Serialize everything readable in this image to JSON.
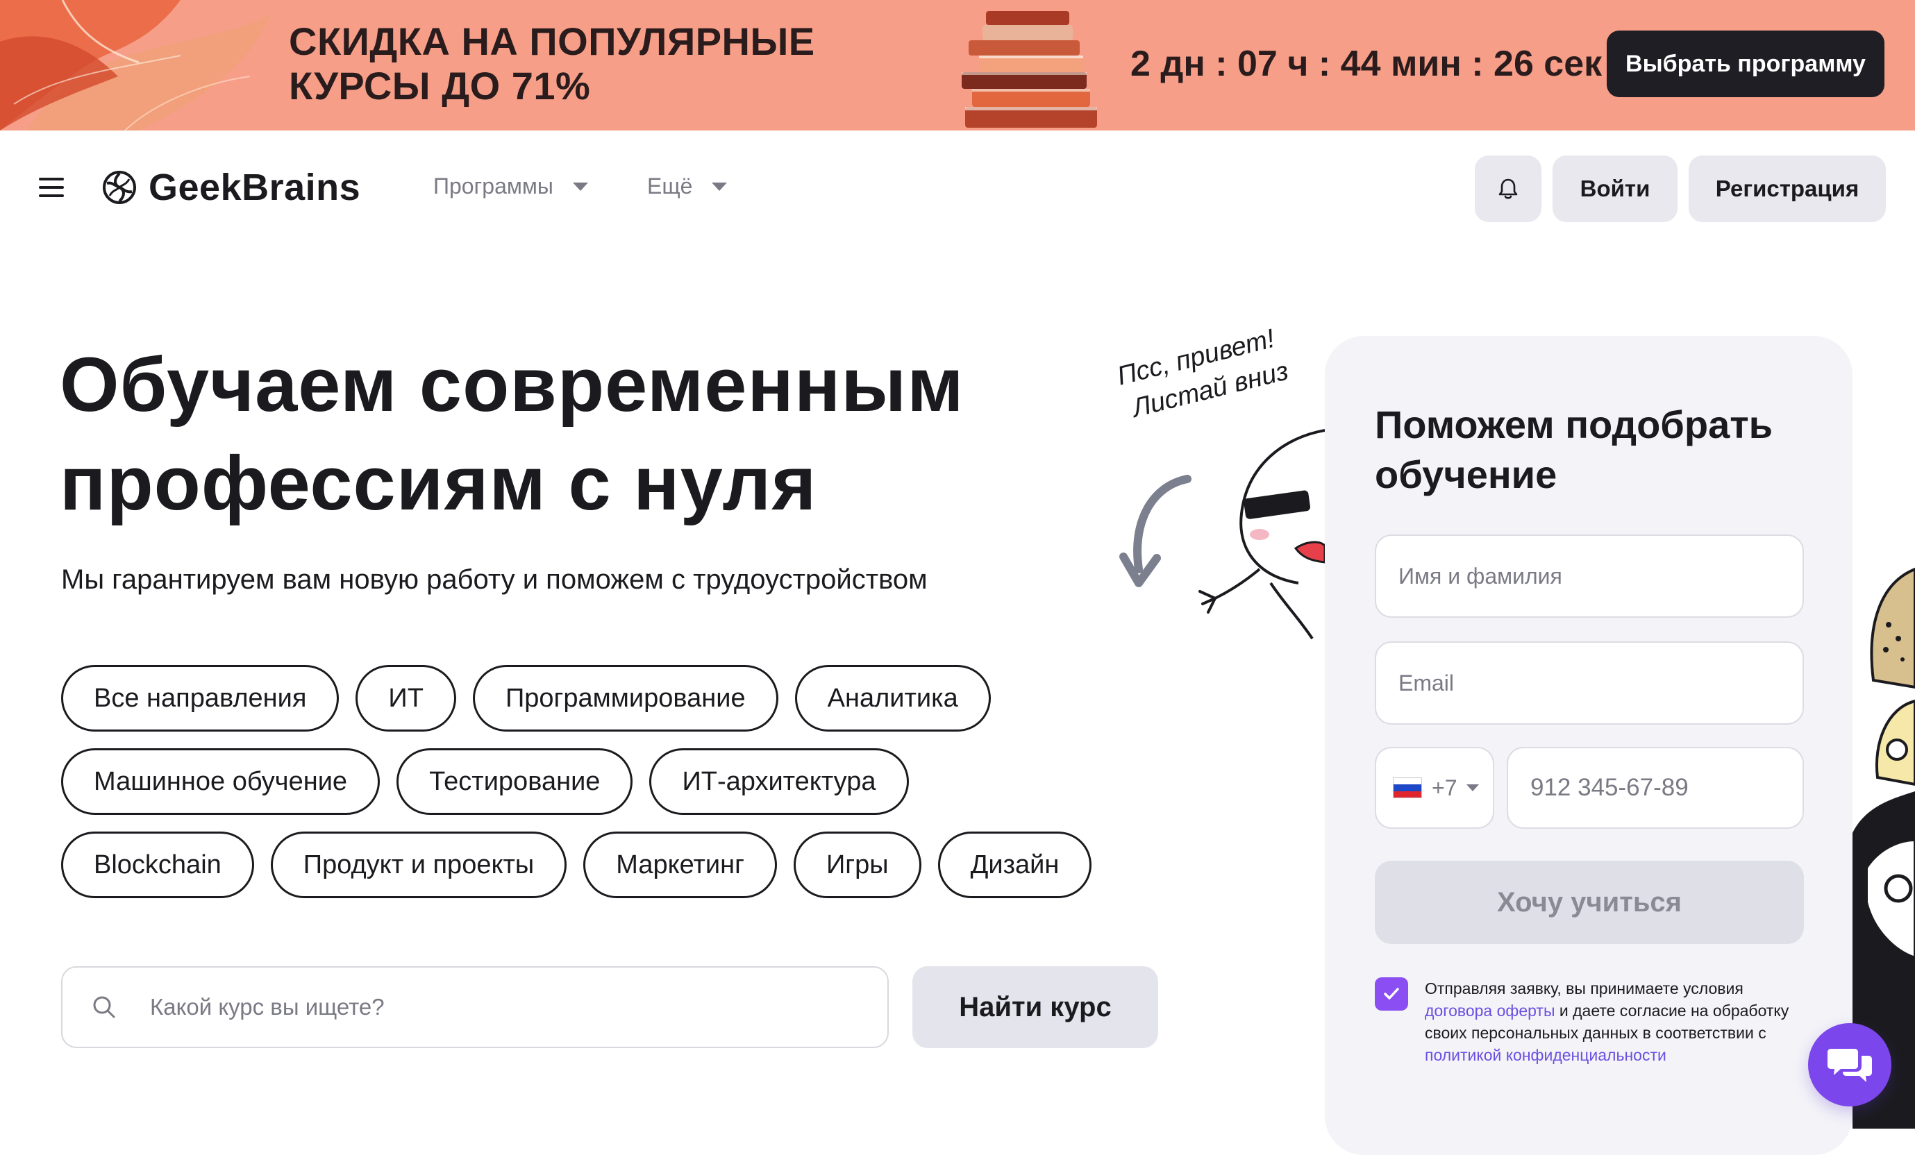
{
  "promo": {
    "title_line1": "СКИДКА НА ПОПУЛЯРНЫЕ",
    "title_line2": "КУРСЫ ДО 71%",
    "timer": "2 дн : 07 ч : 44 мин : 26 сек",
    "button": "Выбрать программу",
    "bg_color": "#f79e89"
  },
  "header": {
    "logo_text": "GeekBrains",
    "nav": [
      "Программы",
      "Ещё"
    ],
    "login": "Войти",
    "register": "Регистрация",
    "icons": [
      "menu-icon",
      "bell-icon"
    ]
  },
  "hero": {
    "title_line1": "Обучаем современным",
    "title_line2": "профессиям с нуля",
    "subtitle": "Мы гарантируем вам новую работу и поможем с трудоустройством",
    "tags": [
      [
        "Все направления",
        "ИТ",
        "Программирование",
        "Аналитика"
      ],
      [
        "Машинное обучение",
        "Тестирование",
        "ИТ-архитектура"
      ],
      [
        "Blockchain",
        "Продукт и проекты",
        "Маркетинг",
        "Игры",
        "Дизайн"
      ]
    ],
    "search_placeholder": "Какой курс вы ищете?",
    "search_button": "Найти курс",
    "mascot_line1": "Псс, привет!",
    "mascot_line2": "Листай вниз"
  },
  "form": {
    "title": "Поможем подобрать обучение",
    "name_placeholder": "Имя и фамилия",
    "email_placeholder": "Email",
    "phone_code": "+7",
    "phone_placeholder": "912 345-67-89",
    "submit": "Хочу учиться",
    "consent": {
      "t1": "Отправляя заявку, вы принимаете условия ",
      "link1": "договора оферты",
      "t2": " и даете согласие на обработку своих персональных данных в соответствии с ",
      "link2": "политикой конфиденциальности"
    },
    "accent_color": "#8a4ef2"
  }
}
